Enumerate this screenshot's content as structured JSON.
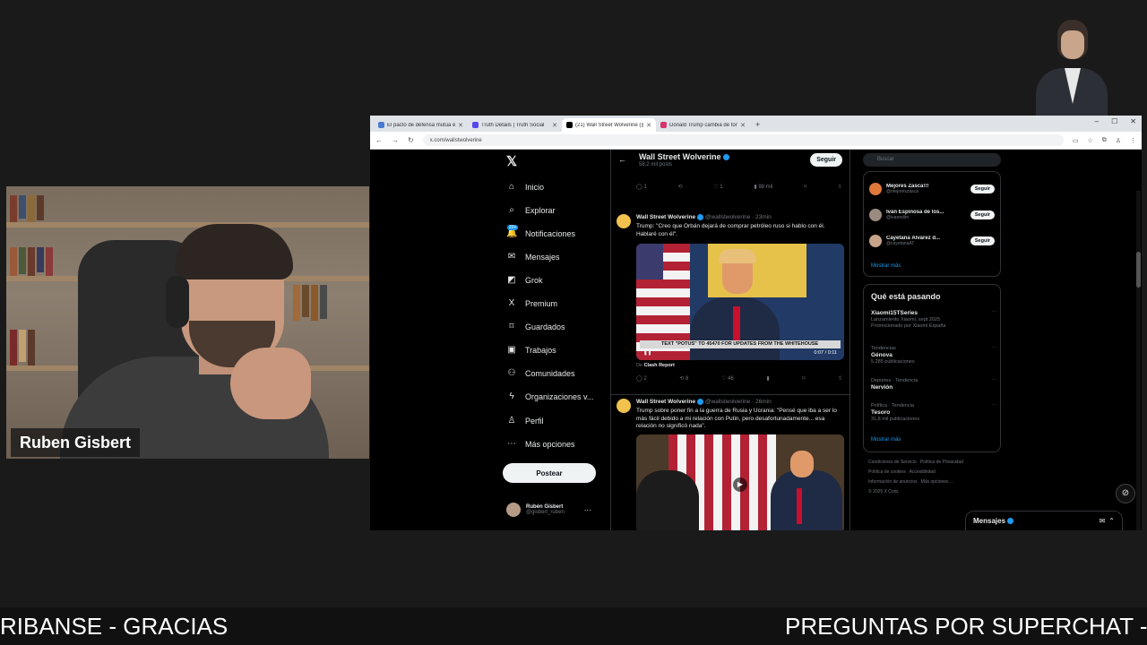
{
  "webcam": {
    "name": "Ruben Gisbert"
  },
  "ticker": {
    "left": "RIBANSE - GRACIAS",
    "right": "PREGUNTAS POR SUPERCHAT -"
  },
  "browser": {
    "tabs": [
      {
        "label": "El pacto de defensa mutua ent",
        "color": "#4a7bd3",
        "active": false
      },
      {
        "label": "Truth Details | Truth Social",
        "color": "#5448ee",
        "active": false
      },
      {
        "label": "(21) Wall Street Wolverine (@w",
        "color": "#000000",
        "active": true
      },
      {
        "label": "Donald Trump cambia de tono",
        "color": "#d6336c",
        "active": false
      }
    ],
    "url": "x.com/wallstwolverine"
  },
  "x": {
    "nav": [
      {
        "label": "Inicio",
        "icon": "home-icon",
        "glyph": "⌂"
      },
      {
        "label": "Explorar",
        "icon": "search-icon",
        "glyph": "⌕"
      },
      {
        "label": "Notificaciones",
        "icon": "bell-icon",
        "glyph": "🔔",
        "badge": "20+"
      },
      {
        "label": "Mensajes",
        "icon": "mail-icon",
        "glyph": "✉"
      },
      {
        "label": "Grok",
        "icon": "grok-icon",
        "glyph": "◩"
      },
      {
        "label": "Premium",
        "icon": "x-premium-icon",
        "glyph": "X"
      },
      {
        "label": "Guardados",
        "icon": "bookmark-icon",
        "glyph": "⌑"
      },
      {
        "label": "Trabajos",
        "icon": "briefcase-icon",
        "glyph": "▣"
      },
      {
        "label": "Comunidades",
        "icon": "people-icon",
        "glyph": "⚇"
      },
      {
        "label": "Organizaciones v...",
        "icon": "lightning-icon",
        "glyph": "ϟ"
      },
      {
        "label": "Perfil",
        "icon": "person-icon",
        "glyph": "♙"
      },
      {
        "label": "Más opciones",
        "icon": "more-circle-icon",
        "glyph": "⋯"
      }
    ],
    "post_label": "Postear",
    "user": {
      "name": "Rubén Gisbert",
      "handle": "@gisbert_ruben"
    },
    "header": {
      "title": "Wall Street Wolverine",
      "subtitle": "58,2 mil posts",
      "follow": "Seguir"
    },
    "top_actions": [
      "1",
      "",
      "1",
      "98 mil",
      "",
      ""
    ],
    "tweets": [
      {
        "name": "Wall Street Wolverine",
        "meta": "@wallstwolverine · 23min",
        "text": "Trump: \"Creo que Orbán dejará de comprar petróleo ruso si hablo con él. Hablaré con él\".",
        "caption": "TEXT \"POTUS\" TO 45470 FOR UPDATES FROM THE WHITEHOUSE",
        "time": "0:07 / 0:11",
        "via": "Clash Report",
        "actions": [
          "2",
          "8",
          "46",
          "",
          "",
          ""
        ]
      },
      {
        "name": "Wall Street Wolverine",
        "meta": "@wallstwolverine · 26min",
        "text": "Trump sobre poner fin a la guerra de Rusia y Ucrania: \"Pensé que iba a ser lo más fácil debido a mi relación con Putin, pero desafortunadamente... esa relación no significó nada\"."
      }
    ],
    "right": {
      "search_placeholder": "Buscar",
      "who": [
        {
          "name": "Mejores Zasca!!!",
          "handle": "@mejoreszasca",
          "follow": "Seguir"
        },
        {
          "name": "Iván Espinosa de los...",
          "handle": "@ivanedlm",
          "follow": "Seguir"
        },
        {
          "name": "Cayetana Álvarez d...",
          "handle": "@cayetanaAT",
          "follow": "Seguir"
        }
      ],
      "show_more": "Mostrar más",
      "trends_title": "Qué está pasando",
      "trends": [
        {
          "name": "Xiaomi15TSeries",
          "sub": "Lanzamiento Xiaomi, sept 2025",
          "context": "Promocionado por Xiaomi España"
        },
        {
          "context": "Tendencias",
          "name": "Génova",
          "sub": "5.285 publicaciones"
        },
        {
          "context": "Deportes · Tendencia",
          "name": "Nervión",
          "sub": ""
        },
        {
          "context": "Política · Tendencia",
          "name": "Tesoro",
          "sub": "31,8 mil publicaciones"
        }
      ],
      "show_more2": "Mostrar más",
      "footer": [
        "Condiciones de Servicio",
        "Política de Privacidad",
        "Política de cookies",
        "Accesibilidad",
        "Información de anuncios",
        "Más opciones ...",
        "© 2025 X Corp."
      ]
    },
    "messages_label": "Mensajes"
  }
}
